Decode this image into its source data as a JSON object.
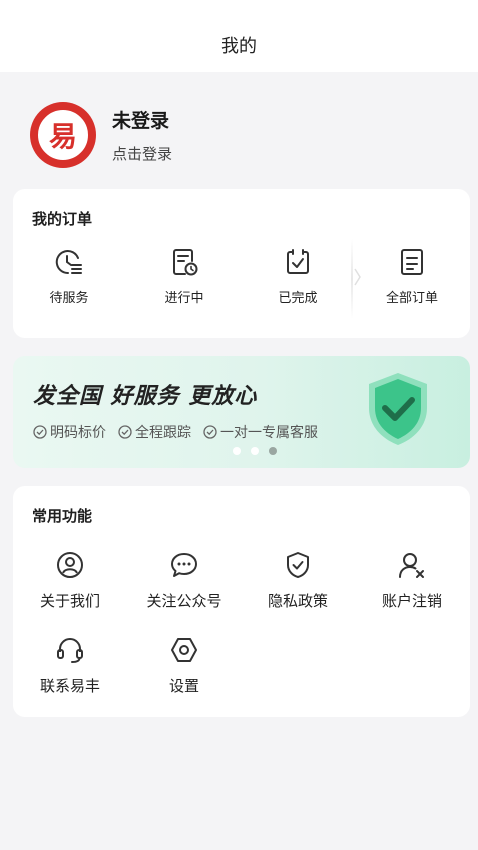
{
  "header": {
    "title": "我的"
  },
  "profile": {
    "avatar_text": "易",
    "name": "未登录",
    "sub": "点击登录"
  },
  "orders": {
    "title": "我的订单",
    "items": [
      {
        "label": "待服务",
        "icon": "clock-list-icon"
      },
      {
        "label": "进行中",
        "icon": "document-clock-icon"
      },
      {
        "label": "已完成",
        "icon": "clipboard-check-icon"
      },
      {
        "label": "全部订单",
        "icon": "document-lines-icon"
      }
    ]
  },
  "banner": {
    "title": "发全国 好服务 更放心",
    "features": [
      "明码标价",
      "全程跟踪",
      "一对一专属客服"
    ],
    "slides": 3,
    "active_slide": 3
  },
  "functions": {
    "title": "常用功能",
    "items": [
      {
        "label": "关于我们",
        "icon": "user-circle-icon"
      },
      {
        "label": "关注公众号",
        "icon": "chat-bubble-icon"
      },
      {
        "label": "隐私政策",
        "icon": "shield-check-icon"
      },
      {
        "label": "账户注销",
        "icon": "user-remove-icon"
      },
      {
        "label": "联系易丰",
        "icon": "headset-icon"
      },
      {
        "label": "设置",
        "icon": "settings-hexagon-icon"
      }
    ]
  },
  "colors": {
    "brand_red": "#d7302b",
    "banner_green": "#3cc48a",
    "background": "#f4f4f6"
  }
}
